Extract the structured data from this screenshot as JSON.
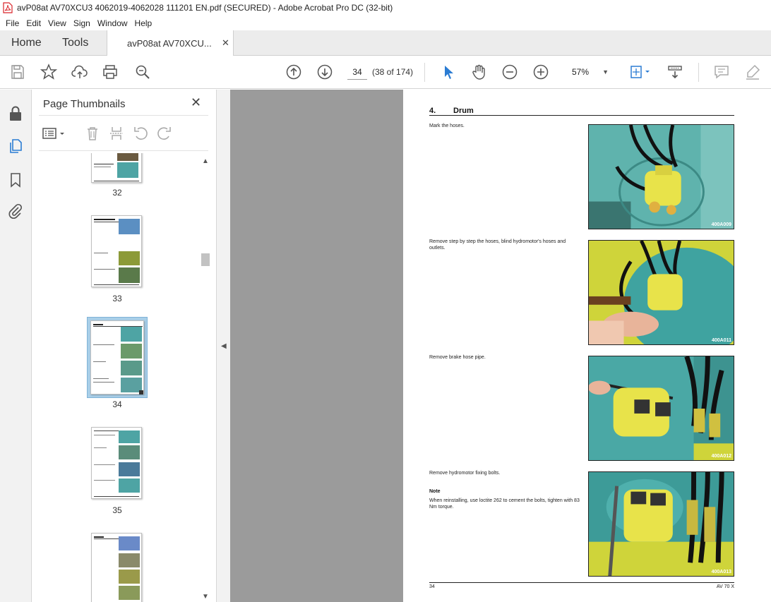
{
  "window": {
    "title": "avP08at AV70XCU3 4062019-4062028 111201 EN.pdf (SECURED) - Adobe Acrobat Pro DC (32-bit)"
  },
  "menu": [
    "File",
    "Edit",
    "View",
    "Sign",
    "Window",
    "Help"
  ],
  "tabs": {
    "home": "Home",
    "tools": "Tools",
    "document": "avP08at AV70XCU...",
    "close_glyph": "✕"
  },
  "toolbar": {
    "page_number": "34",
    "page_count": "(38 of 174)",
    "zoom": "57%",
    "icons": [
      "save-icon",
      "star-icon",
      "upload-icon",
      "print-icon",
      "find-icon",
      "page-up-icon",
      "page-down-icon",
      "select-cursor-icon",
      "hand-icon",
      "zoom-out-icon",
      "zoom-in-icon",
      "fit-page-icon",
      "scroll-mode-icon",
      "comment-icon",
      "highlight-icon"
    ]
  },
  "rail": {
    "icons": [
      "lock-icon",
      "pages-icon",
      "bookmark-icon",
      "attachment-icon"
    ]
  },
  "panel": {
    "title": "Page Thumbnails",
    "close_glyph": "✕",
    "thumbnails": [
      {
        "label": "32"
      },
      {
        "label": "33"
      },
      {
        "label": "34",
        "selected": true
      },
      {
        "label": "35"
      },
      {
        "label": ""
      }
    ]
  },
  "page": {
    "section_number": "4.",
    "section_title": "Drum",
    "steps": [
      {
        "text": "Mark the hoses.",
        "photo_code": "400A009"
      },
      {
        "text": "Remove step by step the hoses, blind hydromotor's hoses and outlets.",
        "photo_code": "400A011"
      },
      {
        "text": "Remove brake hose pipe.",
        "photo_code": "400A012"
      },
      {
        "text": "Remove hydromotor fixing bolts.",
        "photo_code": "400A013"
      }
    ],
    "note_title": "Note",
    "note_text": "When reinstalling, use loctite 262 to cement the bolts, tighten with 83 Nm torque.",
    "footer_left": "34",
    "footer_right": "AV 70 X"
  },
  "colors": {
    "teal": "#2aa5a5",
    "yellow": "#e8e84a",
    "select_blue": "#2b7cd3"
  }
}
